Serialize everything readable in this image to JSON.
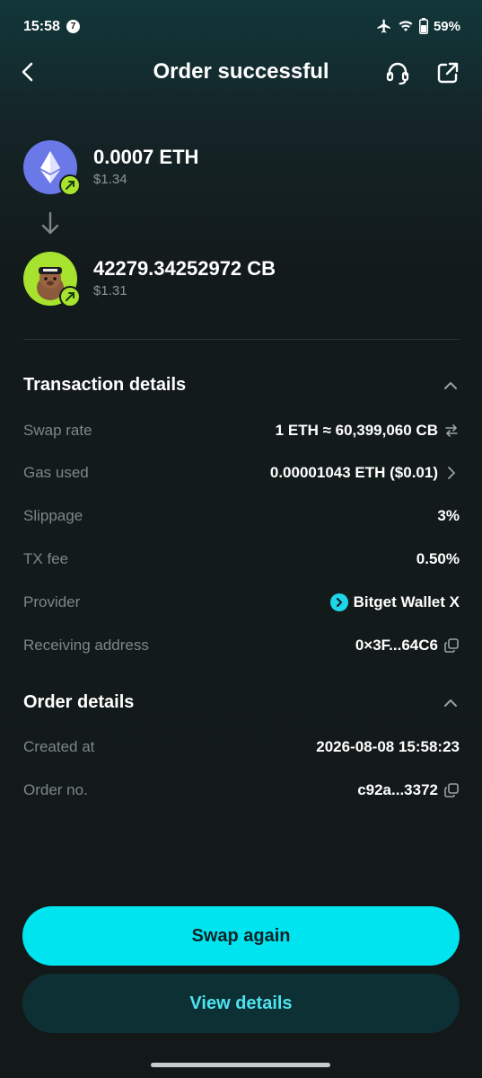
{
  "status_bar": {
    "time": "15:58",
    "notification_count": "7",
    "battery": "59%"
  },
  "header": {
    "title": "Order successful",
    "icons": [
      "back-arrow-icon",
      "headset-support-icon",
      "share-external-icon"
    ]
  },
  "swap": {
    "from": {
      "amount": "0.0007 ETH",
      "usd": "$1.34",
      "icon": "ethereum-icon",
      "accent": "#6a78e8"
    },
    "to": {
      "amount": "42279.34252972 CB",
      "usd": "$1.31",
      "icon": "cb-token-avatar-icon",
      "accent": "#a6e22e"
    }
  },
  "transaction_details": {
    "title": "Transaction details",
    "rows": [
      {
        "label": "Swap rate",
        "value": "1 ETH ≈ 60,399,060 CB"
      },
      {
        "label": "Gas used",
        "value": "0.00001043 ETH ($0.01)"
      },
      {
        "label": "Slippage",
        "value": "3%"
      },
      {
        "label": "TX fee",
        "value": "0.50%"
      },
      {
        "label": "Provider",
        "value": "Bitget Wallet X"
      },
      {
        "label": "Receiving address",
        "value": "0×3F...64C6"
      }
    ]
  },
  "order_details": {
    "title": "Order details",
    "rows": [
      {
        "label": "Created at",
        "value": "2026-08-08 15:58:23"
      },
      {
        "label": "Order no.",
        "value": "c92a...3372"
      }
    ]
  },
  "buttons": {
    "primary": "Swap again",
    "secondary": "View details"
  },
  "colors": {
    "accent": "#00e4f0",
    "secondary_button_bg": "#0d3035",
    "secondary_button_text": "#4ee3ef",
    "label_gray": "#7d8786"
  }
}
